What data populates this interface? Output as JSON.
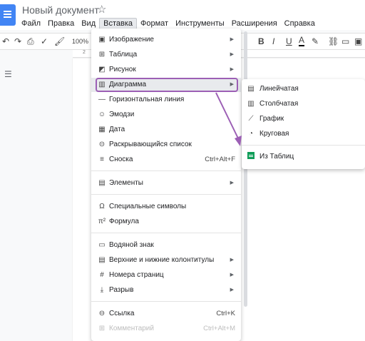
{
  "doc": {
    "title": "Новый документ"
  },
  "menubar": [
    "Файл",
    "Правка",
    "Вид",
    "Вставка",
    "Формат",
    "Инструменты",
    "Расширения",
    "Справка"
  ],
  "toolbar": {
    "zoom": "100%",
    "bold": "B",
    "italic": "I",
    "underline": "U",
    "text_color": "A"
  },
  "ruler": {
    "tick": "2"
  },
  "insert_menu": {
    "items": [
      {
        "icon": "image-icon",
        "label": "Изображение",
        "submenu": true
      },
      {
        "icon": "table-icon",
        "label": "Таблица",
        "submenu": true
      },
      {
        "icon": "drawing-icon",
        "label": "Рисунок",
        "submenu": true
      },
      {
        "icon": "chart-icon",
        "label": "Диаграмма",
        "submenu": true,
        "highlighted": true
      },
      {
        "icon": "horizontal-line-icon",
        "label": "Горизонтальная линия"
      },
      {
        "icon": "emoji-icon",
        "label": "Эмодзи"
      },
      {
        "icon": "date-icon",
        "label": "Дата"
      },
      {
        "icon": "dropdown-icon",
        "label": "Раскрывающийся список"
      },
      {
        "icon": "footnote-icon",
        "label": "Сноска",
        "shortcut": "Ctrl+Alt+F"
      },
      {
        "icon": "building-blocks-icon",
        "label": "Элементы",
        "submenu": true
      },
      {
        "icon": "omega-icon",
        "label": "Специальные символы"
      },
      {
        "icon": "equation-icon",
        "label": "Формула"
      },
      {
        "icon": "watermark-icon",
        "label": "Водяной знак"
      },
      {
        "icon": "header-footer-icon",
        "label": "Верхние и нижние колонтитулы",
        "submenu": true
      },
      {
        "icon": "page-numbers-icon",
        "label": "Номера страниц",
        "submenu": true
      },
      {
        "icon": "break-icon",
        "label": "Разрыв",
        "submenu": true
      },
      {
        "icon": "link-icon",
        "label": "Ссылка",
        "shortcut": "Ctrl+K"
      },
      {
        "icon": "comment-icon",
        "label": "Комментарий",
        "shortcut": "Ctrl+Alt+M",
        "disabled": true
      }
    ]
  },
  "chart_submenu": {
    "items": [
      {
        "icon": "bar-chart-icon",
        "label": "Линейчатая"
      },
      {
        "icon": "column-chart-icon",
        "label": "Столбчатая"
      },
      {
        "icon": "line-chart-icon",
        "label": "График"
      },
      {
        "icon": "pie-chart-icon",
        "label": "Круговая"
      },
      {
        "icon": "sheets-icon",
        "label": "Из Таблиц"
      }
    ]
  },
  "annotation": {
    "color": "#9c5fb5"
  }
}
